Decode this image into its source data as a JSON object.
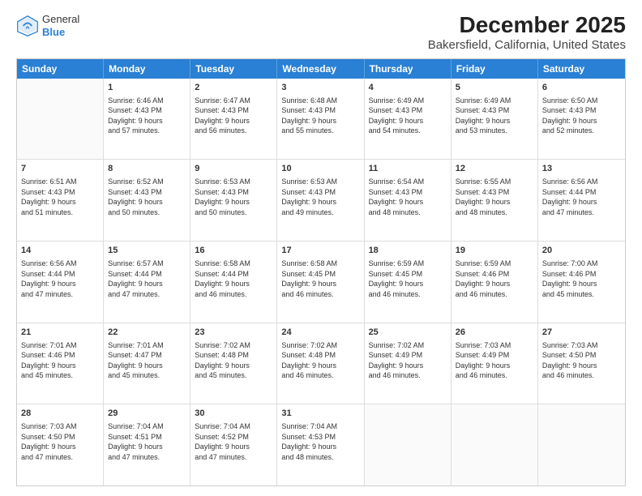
{
  "header": {
    "logo_general": "General",
    "logo_blue": "Blue",
    "title": "December 2025",
    "subtitle": "Bakersfield, California, United States"
  },
  "days_of_week": [
    "Sunday",
    "Monday",
    "Tuesday",
    "Wednesday",
    "Thursday",
    "Friday",
    "Saturday"
  ],
  "weeks": [
    [
      {
        "num": "",
        "lines": []
      },
      {
        "num": "1",
        "lines": [
          "Sunrise: 6:46 AM",
          "Sunset: 4:43 PM",
          "Daylight: 9 hours",
          "and 57 minutes."
        ]
      },
      {
        "num": "2",
        "lines": [
          "Sunrise: 6:47 AM",
          "Sunset: 4:43 PM",
          "Daylight: 9 hours",
          "and 56 minutes."
        ]
      },
      {
        "num": "3",
        "lines": [
          "Sunrise: 6:48 AM",
          "Sunset: 4:43 PM",
          "Daylight: 9 hours",
          "and 55 minutes."
        ]
      },
      {
        "num": "4",
        "lines": [
          "Sunrise: 6:49 AM",
          "Sunset: 4:43 PM",
          "Daylight: 9 hours",
          "and 54 minutes."
        ]
      },
      {
        "num": "5",
        "lines": [
          "Sunrise: 6:49 AM",
          "Sunset: 4:43 PM",
          "Daylight: 9 hours",
          "and 53 minutes."
        ]
      },
      {
        "num": "6",
        "lines": [
          "Sunrise: 6:50 AM",
          "Sunset: 4:43 PM",
          "Daylight: 9 hours",
          "and 52 minutes."
        ]
      }
    ],
    [
      {
        "num": "7",
        "lines": [
          "Sunrise: 6:51 AM",
          "Sunset: 4:43 PM",
          "Daylight: 9 hours",
          "and 51 minutes."
        ]
      },
      {
        "num": "8",
        "lines": [
          "Sunrise: 6:52 AM",
          "Sunset: 4:43 PM",
          "Daylight: 9 hours",
          "and 50 minutes."
        ]
      },
      {
        "num": "9",
        "lines": [
          "Sunrise: 6:53 AM",
          "Sunset: 4:43 PM",
          "Daylight: 9 hours",
          "and 50 minutes."
        ]
      },
      {
        "num": "10",
        "lines": [
          "Sunrise: 6:53 AM",
          "Sunset: 4:43 PM",
          "Daylight: 9 hours",
          "and 49 minutes."
        ]
      },
      {
        "num": "11",
        "lines": [
          "Sunrise: 6:54 AM",
          "Sunset: 4:43 PM",
          "Daylight: 9 hours",
          "and 48 minutes."
        ]
      },
      {
        "num": "12",
        "lines": [
          "Sunrise: 6:55 AM",
          "Sunset: 4:43 PM",
          "Daylight: 9 hours",
          "and 48 minutes."
        ]
      },
      {
        "num": "13",
        "lines": [
          "Sunrise: 6:56 AM",
          "Sunset: 4:44 PM",
          "Daylight: 9 hours",
          "and 47 minutes."
        ]
      }
    ],
    [
      {
        "num": "14",
        "lines": [
          "Sunrise: 6:56 AM",
          "Sunset: 4:44 PM",
          "Daylight: 9 hours",
          "and 47 minutes."
        ]
      },
      {
        "num": "15",
        "lines": [
          "Sunrise: 6:57 AM",
          "Sunset: 4:44 PM",
          "Daylight: 9 hours",
          "and 47 minutes."
        ]
      },
      {
        "num": "16",
        "lines": [
          "Sunrise: 6:58 AM",
          "Sunset: 4:44 PM",
          "Daylight: 9 hours",
          "and 46 minutes."
        ]
      },
      {
        "num": "17",
        "lines": [
          "Sunrise: 6:58 AM",
          "Sunset: 4:45 PM",
          "Daylight: 9 hours",
          "and 46 minutes."
        ]
      },
      {
        "num": "18",
        "lines": [
          "Sunrise: 6:59 AM",
          "Sunset: 4:45 PM",
          "Daylight: 9 hours",
          "and 46 minutes."
        ]
      },
      {
        "num": "19",
        "lines": [
          "Sunrise: 6:59 AM",
          "Sunset: 4:46 PM",
          "Daylight: 9 hours",
          "and 46 minutes."
        ]
      },
      {
        "num": "20",
        "lines": [
          "Sunrise: 7:00 AM",
          "Sunset: 4:46 PM",
          "Daylight: 9 hours",
          "and 45 minutes."
        ]
      }
    ],
    [
      {
        "num": "21",
        "lines": [
          "Sunrise: 7:01 AM",
          "Sunset: 4:46 PM",
          "Daylight: 9 hours",
          "and 45 minutes."
        ]
      },
      {
        "num": "22",
        "lines": [
          "Sunrise: 7:01 AM",
          "Sunset: 4:47 PM",
          "Daylight: 9 hours",
          "and 45 minutes."
        ]
      },
      {
        "num": "23",
        "lines": [
          "Sunrise: 7:02 AM",
          "Sunset: 4:48 PM",
          "Daylight: 9 hours",
          "and 45 minutes."
        ]
      },
      {
        "num": "24",
        "lines": [
          "Sunrise: 7:02 AM",
          "Sunset: 4:48 PM",
          "Daylight: 9 hours",
          "and 46 minutes."
        ]
      },
      {
        "num": "25",
        "lines": [
          "Sunrise: 7:02 AM",
          "Sunset: 4:49 PM",
          "Daylight: 9 hours",
          "and 46 minutes."
        ]
      },
      {
        "num": "26",
        "lines": [
          "Sunrise: 7:03 AM",
          "Sunset: 4:49 PM",
          "Daylight: 9 hours",
          "and 46 minutes."
        ]
      },
      {
        "num": "27",
        "lines": [
          "Sunrise: 7:03 AM",
          "Sunset: 4:50 PM",
          "Daylight: 9 hours",
          "and 46 minutes."
        ]
      }
    ],
    [
      {
        "num": "28",
        "lines": [
          "Sunrise: 7:03 AM",
          "Sunset: 4:50 PM",
          "Daylight: 9 hours",
          "and 47 minutes."
        ]
      },
      {
        "num": "29",
        "lines": [
          "Sunrise: 7:04 AM",
          "Sunset: 4:51 PM",
          "Daylight: 9 hours",
          "and 47 minutes."
        ]
      },
      {
        "num": "30",
        "lines": [
          "Sunrise: 7:04 AM",
          "Sunset: 4:52 PM",
          "Daylight: 9 hours",
          "and 47 minutes."
        ]
      },
      {
        "num": "31",
        "lines": [
          "Sunrise: 7:04 AM",
          "Sunset: 4:53 PM",
          "Daylight: 9 hours",
          "and 48 minutes."
        ]
      },
      {
        "num": "",
        "lines": []
      },
      {
        "num": "",
        "lines": []
      },
      {
        "num": "",
        "lines": []
      }
    ]
  ]
}
